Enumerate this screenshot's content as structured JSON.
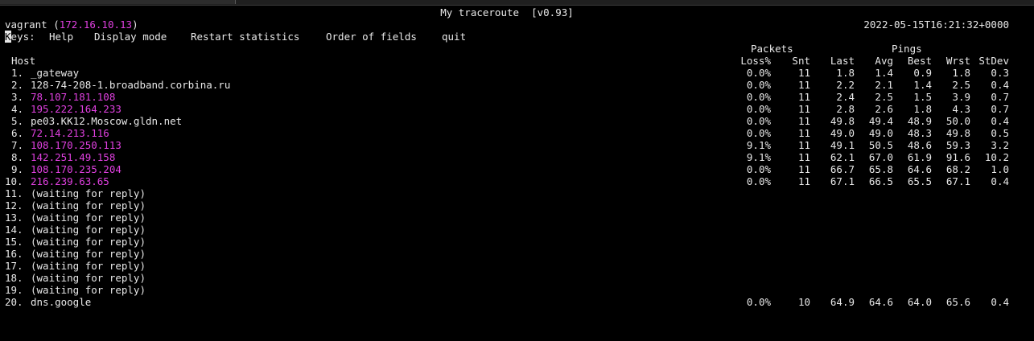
{
  "window": {
    "title": "My traceroute  [v0.93]"
  },
  "header": {
    "host_name": "vagrant",
    "host_ip": "172.16.10.13",
    "timestamp": "2022-05-15T16:21:32+0000"
  },
  "keys": {
    "label_first": "K",
    "label_rest": "eys:",
    "items": [
      "Help",
      "Display mode",
      "Restart statistics",
      "Order of fields",
      "quit"
    ]
  },
  "columns": {
    "group_packets": "Packets",
    "group_pings": "Pings",
    "host": "Host",
    "loss": "Loss%",
    "snt": "Snt",
    "last": "Last",
    "avg": "Avg",
    "best": "Best",
    "wrst": "Wrst",
    "stdev": "StDev"
  },
  "colors": {
    "background": "#000000",
    "text": "#e8e8e8",
    "ip_highlight": "#e040e0"
  },
  "hops": [
    {
      "num": "1.",
      "host": "_gateway",
      "ip": false,
      "loss": "0.0%",
      "snt": "11",
      "last": "1.8",
      "avg": "1.4",
      "best": "0.9",
      "wrst": "1.8",
      "stdev": "0.3"
    },
    {
      "num": "2.",
      "host": "128-74-208-1.broadband.corbina.ru",
      "ip": false,
      "loss": "0.0%",
      "snt": "11",
      "last": "2.2",
      "avg": "2.1",
      "best": "1.4",
      "wrst": "2.5",
      "stdev": "0.4"
    },
    {
      "num": "3.",
      "host": "78.107.181.108",
      "ip": true,
      "loss": "0.0%",
      "snt": "11",
      "last": "2.4",
      "avg": "2.5",
      "best": "1.5",
      "wrst": "3.9",
      "stdev": "0.7"
    },
    {
      "num": "4.",
      "host": "195.222.164.233",
      "ip": true,
      "loss": "0.0%",
      "snt": "11",
      "last": "2.8",
      "avg": "2.6",
      "best": "1.8",
      "wrst": "4.3",
      "stdev": "0.7"
    },
    {
      "num": "5.",
      "host": "pe03.KK12.Moscow.gldn.net",
      "ip": false,
      "loss": "0.0%",
      "snt": "11",
      "last": "49.8",
      "avg": "49.4",
      "best": "48.9",
      "wrst": "50.0",
      "stdev": "0.4"
    },
    {
      "num": "6.",
      "host": "72.14.213.116",
      "ip": true,
      "loss": "0.0%",
      "snt": "11",
      "last": "49.0",
      "avg": "49.0",
      "best": "48.3",
      "wrst": "49.8",
      "stdev": "0.5"
    },
    {
      "num": "7.",
      "host": "108.170.250.113",
      "ip": true,
      "loss": "9.1%",
      "snt": "11",
      "last": "49.1",
      "avg": "50.5",
      "best": "48.6",
      "wrst": "59.3",
      "stdev": "3.2"
    },
    {
      "num": "8.",
      "host": "142.251.49.158",
      "ip": true,
      "loss": "9.1%",
      "snt": "11",
      "last": "62.1",
      "avg": "67.0",
      "best": "61.9",
      "wrst": "91.6",
      "stdev": "10.2"
    },
    {
      "num": "9.",
      "host": "108.170.235.204",
      "ip": true,
      "loss": "0.0%",
      "snt": "11",
      "last": "66.7",
      "avg": "65.8",
      "best": "64.6",
      "wrst": "68.2",
      "stdev": "1.0"
    },
    {
      "num": "10.",
      "host": "216.239.63.65",
      "ip": true,
      "loss": "0.0%",
      "snt": "11",
      "last": "67.1",
      "avg": "66.5",
      "best": "65.5",
      "wrst": "67.1",
      "stdev": "0.4"
    },
    {
      "num": "11.",
      "host": "(waiting for reply)",
      "ip": false
    },
    {
      "num": "12.",
      "host": "(waiting for reply)",
      "ip": false
    },
    {
      "num": "13.",
      "host": "(waiting for reply)",
      "ip": false
    },
    {
      "num": "14.",
      "host": "(waiting for reply)",
      "ip": false
    },
    {
      "num": "15.",
      "host": "(waiting for reply)",
      "ip": false
    },
    {
      "num": "16.",
      "host": "(waiting for reply)",
      "ip": false
    },
    {
      "num": "17.",
      "host": "(waiting for reply)",
      "ip": false
    },
    {
      "num": "18.",
      "host": "(waiting for reply)",
      "ip": false
    },
    {
      "num": "19.",
      "host": "(waiting for reply)",
      "ip": false
    },
    {
      "num": "20.",
      "host": "dns.google",
      "ip": false,
      "loss": "0.0%",
      "snt": "10",
      "last": "64.9",
      "avg": "64.6",
      "best": "64.0",
      "wrst": "65.6",
      "stdev": "0.4"
    }
  ]
}
